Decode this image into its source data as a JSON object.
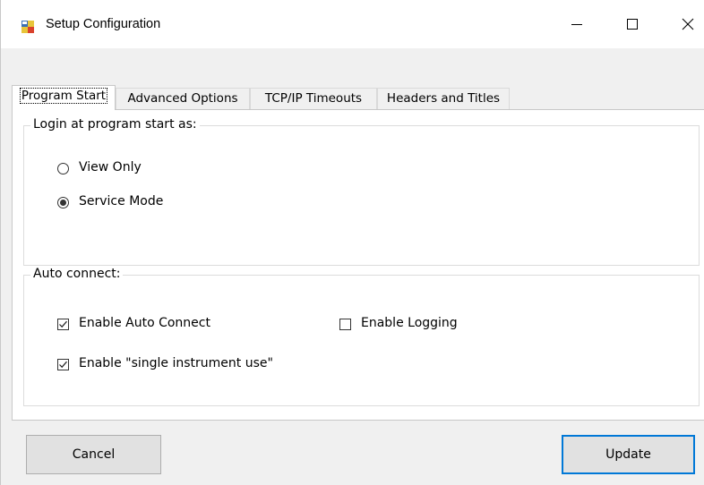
{
  "window": {
    "title": "Setup Configuration",
    "controls": {
      "minimize_icon": "minimize-icon",
      "maximize_icon": "maximize-icon",
      "close_icon": "close-icon"
    }
  },
  "tabs": [
    {
      "label": "Program Start",
      "active": true
    },
    {
      "label": "Advanced Options",
      "active": false
    },
    {
      "label": "TCP/IP Timeouts",
      "active": false
    },
    {
      "label": "Headers and Titles",
      "active": false
    }
  ],
  "login_group": {
    "label": "Login at program start as:",
    "options": [
      {
        "label": "View Only",
        "selected": false
      },
      {
        "label": "Service Mode",
        "selected": true
      }
    ]
  },
  "auto_connect_group": {
    "label": "Auto connect:",
    "enable_auto_connect": {
      "label": "Enable Auto Connect",
      "checked": true
    },
    "enable_logging": {
      "label": "Enable Logging",
      "checked": false
    },
    "single_instrument": {
      "label": "Enable \"single instrument use\"",
      "checked": true
    }
  },
  "buttons": {
    "cancel": "Cancel",
    "update": "Update"
  },
  "colors": {
    "accent": "#0078d7",
    "button_face": "#e1e1e1",
    "dialog_bg": "#f0f0f0"
  }
}
